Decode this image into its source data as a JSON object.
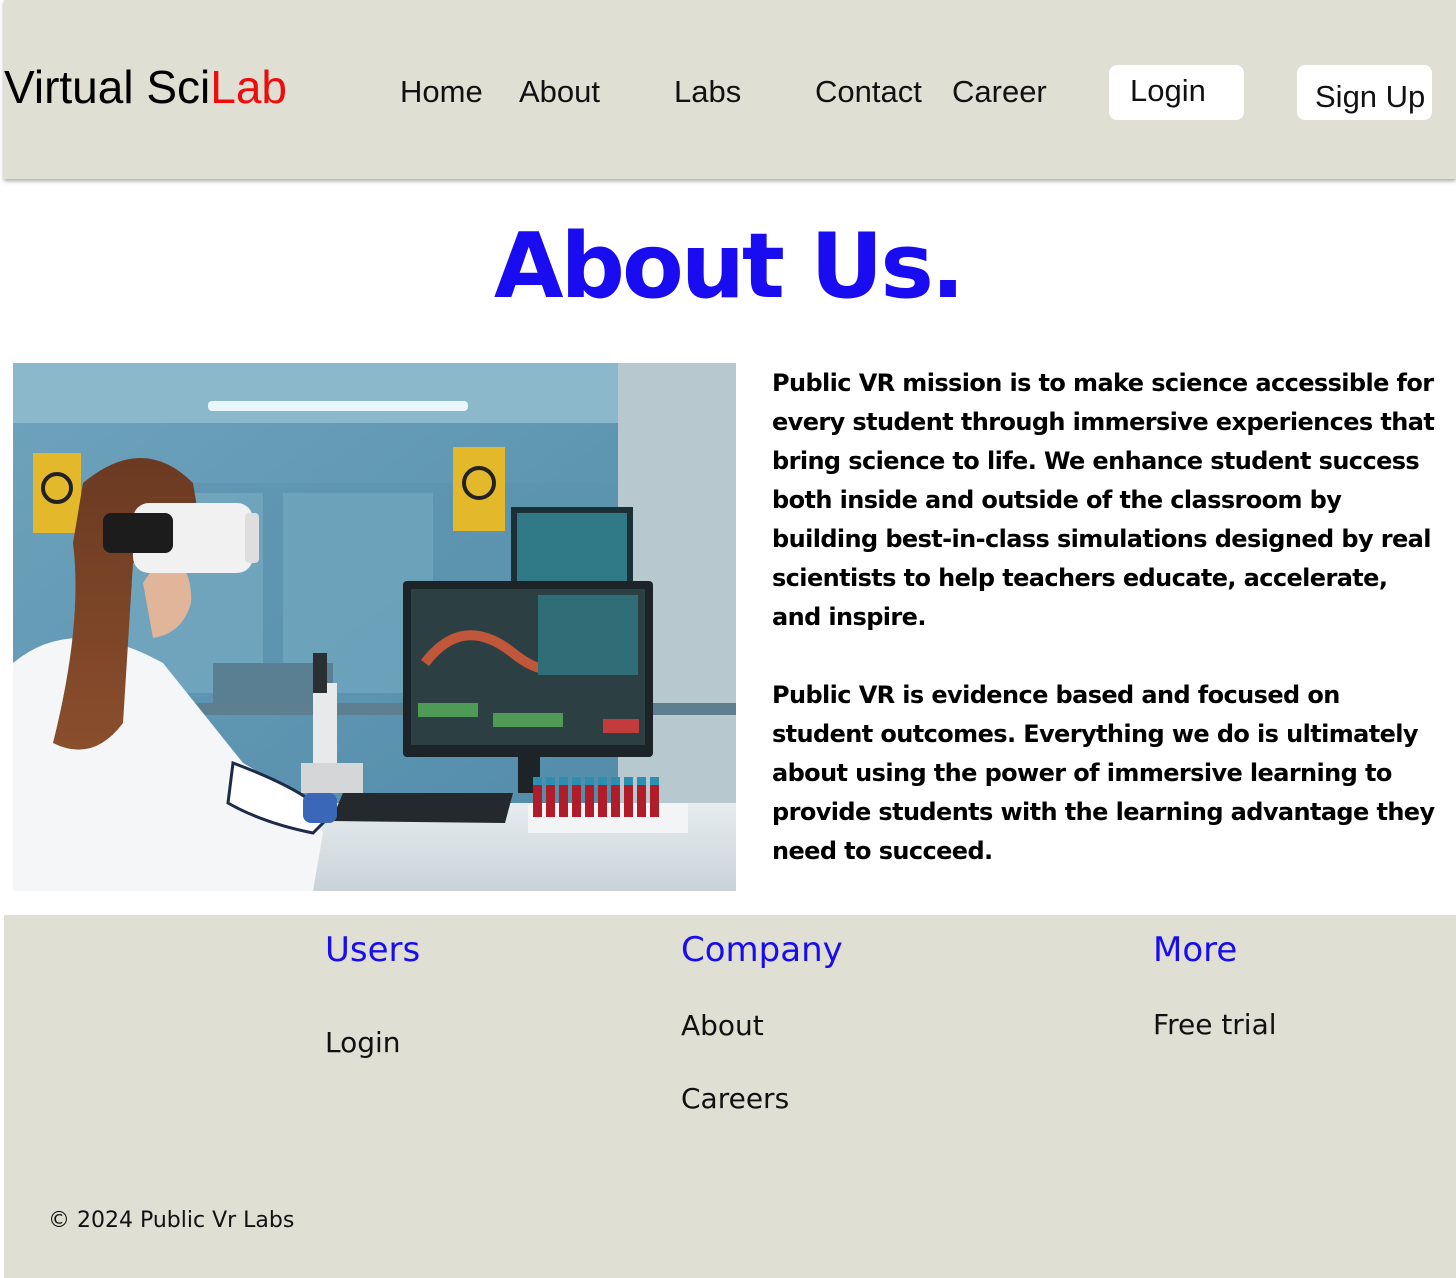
{
  "header": {
    "logo_part1": "Virtual Sci",
    "logo_part2": "Lab",
    "nav": [
      "Home",
      "About",
      "Labs",
      "Contact",
      "Career"
    ],
    "login_label": "Login",
    "signup_label": "Sign Up"
  },
  "main": {
    "title": "About Us.",
    "paragraphs": [
      "Public VR mission is to make science accessible for every student through immersive experiences that bring science to life. We enhance student success both inside and outside of the classroom by building best-in-class simulations designed by real scientists to help teachers educate, accelerate, and inspire.",
      "Public VR is evidence based and focused on student outcomes. Everything we do is ultimately about using the power of immersive learning to provide students with the learning advantage they need to succeed."
    ]
  },
  "footer": {
    "columns": [
      {
        "heading": "Users",
        "links": [
          "Login"
        ]
      },
      {
        "heading": "Company",
        "links": [
          "About",
          "Careers"
        ]
      },
      {
        "heading": "More",
        "links": [
          "Free trial"
        ]
      }
    ],
    "copyright": "© 2024 Public Vr Labs"
  },
  "colors": {
    "brand_accent": "#ee0c0c",
    "title_blue": "#1a0cf0",
    "header_bg": "#dfdfd4",
    "footer_bg": "#dfdfd4"
  }
}
